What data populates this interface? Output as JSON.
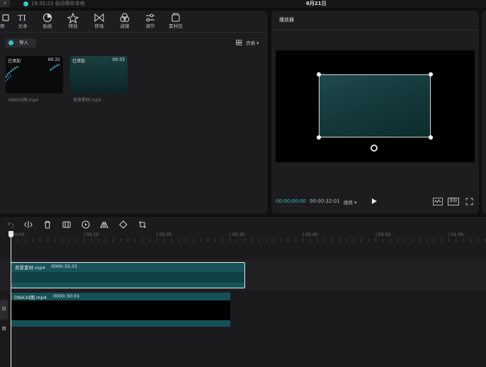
{
  "topbar": {
    "menu_glyph": "∨",
    "save_status": "19:35:23 自动保存本地",
    "project_title": "6月21日"
  },
  "toolbar": {
    "items": [
      {
        "label": "",
        "icon": "media-icon"
      },
      {
        "label": "文本",
        "icon": "text-icon"
      },
      {
        "label": "贴纸",
        "icon": "sticker-icon"
      },
      {
        "label": "特效",
        "icon": "effects-icon"
      },
      {
        "label": "转场",
        "icon": "transition-icon"
      },
      {
        "label": "滤镜",
        "icon": "filter-icon"
      },
      {
        "label": "调节",
        "icon": "adjust-icon"
      },
      {
        "label": "素材包",
        "icon": "asset-pack-icon"
      }
    ]
  },
  "media": {
    "import_label": "导入",
    "sort_label": "宫格",
    "items": [
      {
        "tag": "已添加",
        "duration": "00:31",
        "name": "DNA3d图.mp4"
      },
      {
        "tag": "已添加",
        "duration": "00:33",
        "name": "背景素材.mp4"
      }
    ]
  },
  "player": {
    "title": "播放器",
    "current_time": "00:00:00:00",
    "total_time": "00:00:32:01",
    "ratio_label": "画质",
    "original_label": "原始"
  },
  "timeline": {
    "ruler_labels": [
      "00:00",
      "| 00:10",
      "| 00:20",
      "| 00:30",
      "| 00:40",
      "| 00:50",
      "| 01:00"
    ],
    "cover_label": "封面",
    "clips": [
      {
        "name": "背景素材.mp4",
        "time": "0000:32:01"
      },
      {
        "name": "DNA3d图.mp4",
        "time": "0000:30:01"
      }
    ]
  },
  "colors": {
    "accent": "#2fc7d0",
    "clip_teal": "#16545a",
    "panel": "#1d1d1f",
    "background": "#0f0f10"
  }
}
